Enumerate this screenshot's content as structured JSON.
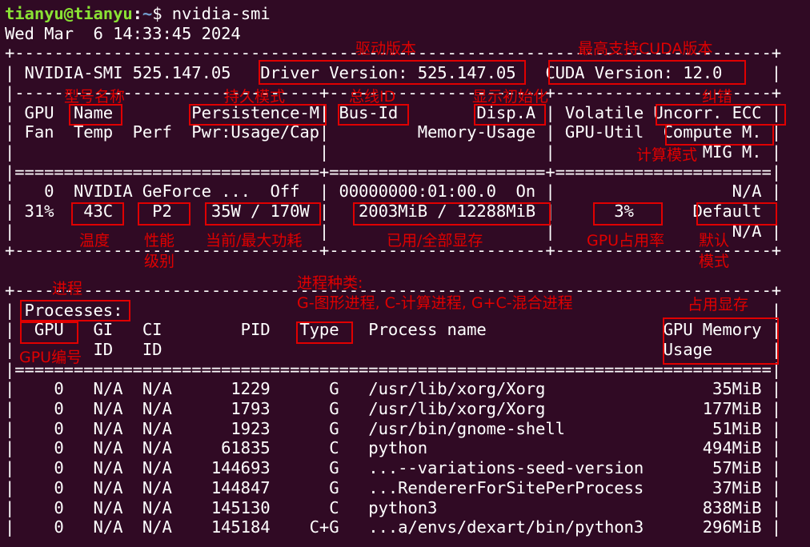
{
  "terminal": {
    "prompt": {
      "user_host": "tianyu@tianyu",
      "colon": ":",
      "path": "~",
      "symbol": "$",
      "command": "nvidia-smi"
    },
    "timestamp": "Wed Mar  6 14:33:45 2024"
  },
  "smi": {
    "border_top": "+-----------------------------------------------------------------------------+",
    "version_line": "| NVIDIA-SMI 525.147.05   Driver Version: 525.147.05   CUDA Version: 12.0     |",
    "sep_dash": "|-------------------------------+----------------------+----------------------+",
    "header_1": "| GPU  Name        Persistence-M| Bus-Id        Disp.A | Volatile Uncorr. ECC |",
    "header_2": "| Fan  Temp  Perf  Pwr:Usage/Cap|         Memory-Usage | GPU-Util  Compute M. |",
    "header_3": "|                               |                      |               MIG M. |",
    "sep_eq": "|===============================+======================+======================|",
    "gpu_row_1": "|   0  NVIDIA GeForce ...  Off  | 00000000:01:00.0  On |                  N/A |",
    "gpu_row_2": "| 31%   43C    P2    35W / 170W |   2003MiB / 12288MiB |      3%      Default |",
    "gpu_row_3": "|                               |                      |                  N/A |",
    "gpu_bottom": "+-------------------------------+----------------------+----------------------+",
    "blank_line": "",
    "proc_top": "+-----------------------------------------------------------------------------+",
    "proc_title": "| Processes:                                                                  |",
    "proc_header_1": "|  GPU   GI   CI        PID   Type   Process name                  GPU Memory |",
    "proc_header_2": "|        ID   ID                                                   Usage      |",
    "proc_sep": "|=============================================================================|",
    "processes": [
      "|    0   N/A  N/A      1229      G   /usr/lib/xorg/Xorg                 35MiB |",
      "|    0   N/A  N/A      1793      G   /usr/lib/xorg/Xorg                177MiB |",
      "|    0   N/A  N/A      1923      G   /usr/bin/gnome-shell               51MiB |",
      "|    0   N/A  N/A     61835      C   python                            494MiB |",
      "|    0   N/A  N/A    144693      G   ...--variations-seed-version       57MiB |",
      "|    0   N/A  N/A    144847      G   ...RendererForSitePerProcess       37MiB |",
      "|    0   N/A  N/A    145130      C   python3                           838MiB |",
      "|    0   N/A  N/A    145184    C+G   ...a/envs/dexart/bin/python3      296MiB |"
    ]
  },
  "annotations": {
    "driver_version": "驱动版本",
    "cuda_version": "最高支持CUDA版本",
    "model_name": "型号名称",
    "persistence": "持久模式",
    "bus_id": "总线ID",
    "display_init": "显示初始化",
    "ecc": "纠错",
    "compute_mode": "计算模式",
    "temperature": "温度",
    "perf_level_1": "性能",
    "perf_level_2": "级别",
    "power": "当前/最大功耗",
    "memory_usage": "已用/全部显存",
    "gpu_util": "GPU占用率",
    "default_mode_1": "默认",
    "default_mode_2": "模式",
    "processes": "进程",
    "process_type_1": "进程种类:",
    "process_type_2": "G-图形进程, C-计算进程, G+C-混合进程",
    "gpu_mem_used": "占用显存",
    "gpu_index": "GPU编号"
  },
  "colors": {
    "background": "#300a24",
    "text": "#ffffff",
    "prompt_user": "#8ae234",
    "prompt_path": "#729fcf",
    "annotation": "#e00000"
  }
}
